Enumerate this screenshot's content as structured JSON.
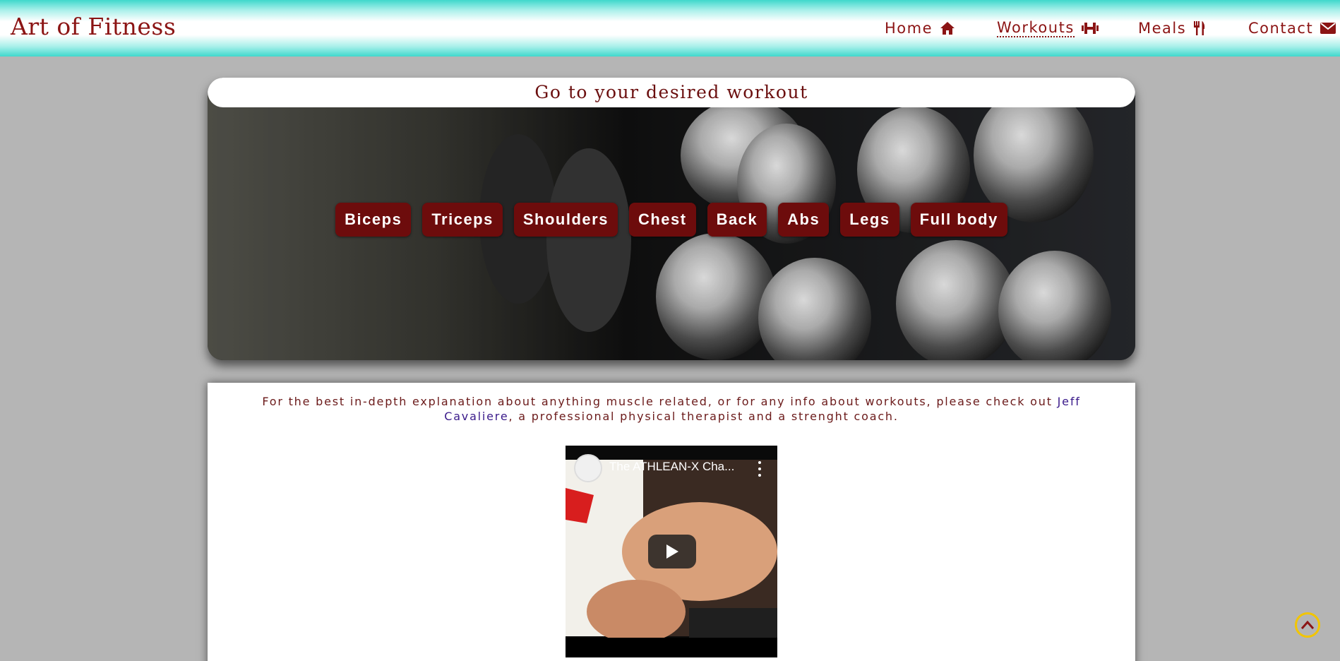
{
  "brand": "Art of Fitness",
  "nav": {
    "items": [
      {
        "label": "Home",
        "icon": "home-icon"
      },
      {
        "label": "Workouts",
        "icon": "dumbbell-icon",
        "active": true
      },
      {
        "label": "Meals",
        "icon": "utensils-icon"
      },
      {
        "label": "Contact",
        "icon": "envelope-icon"
      }
    ]
  },
  "hero": {
    "title": "Go to your desired workout",
    "buttons": [
      "Biceps",
      "Triceps",
      "Shoulders",
      "Chest",
      "Back",
      "Abs",
      "Legs",
      "Full body"
    ]
  },
  "content": {
    "intro_before": "For the best in-depth explanation about anything muscle related, or for any info about workouts, please check out ",
    "intro_link": "Jeff Cavaliere",
    "intro_after": ", a professional physical therapist and a strenght coach.",
    "video_title": "The ATHLEAN-X Cha..."
  },
  "colors": {
    "brand": "#8b1414",
    "button_bg": "#6d0c0c",
    "accent_teal": "#3fd8cc",
    "page_bg": "#b5b5b5",
    "scroll_ring": "#f2c500"
  }
}
